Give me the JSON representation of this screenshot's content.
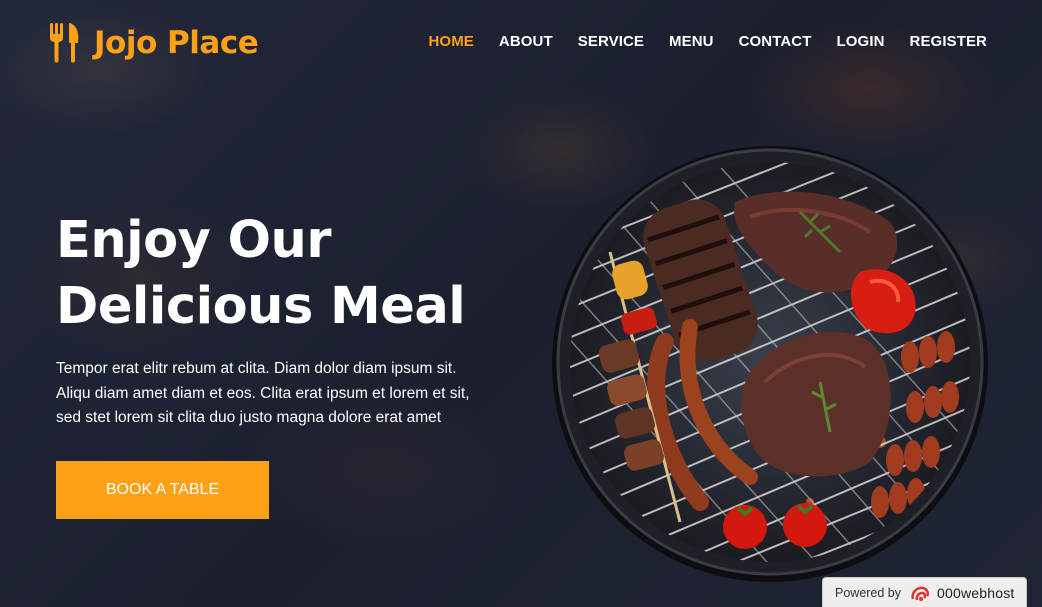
{
  "brand": {
    "name": "Jojo Place",
    "icon": "utensils-icon",
    "color": "#FEA116"
  },
  "nav": {
    "items": [
      {
        "label": "HOME",
        "active": true
      },
      {
        "label": "ABOUT",
        "active": false
      },
      {
        "label": "SERVICE",
        "active": false
      },
      {
        "label": "MENU",
        "active": false
      },
      {
        "label": "CONTACT",
        "active": false
      },
      {
        "label": "LOGIN",
        "active": false
      },
      {
        "label": "REGISTER",
        "active": false
      }
    ]
  },
  "hero": {
    "title_line1": "Enjoy Our",
    "title_line2": "Delicious Meal",
    "text_line1": "Tempor erat elitr rebum at clita. Diam dolor diam ipsum sit.",
    "text_line2": "Aliqu diam amet diam et eos. Clita erat ipsum et lorem et sit,",
    "text_line3": "sed stet lorem sit clita duo justo magna dolore erat amet",
    "cta_label": "BOOK A TABLE",
    "image": "bbq-grill-image"
  },
  "footer_badge": {
    "prefix": "Powered by",
    "host": "000webhost",
    "icon": "000webhost-logo-icon"
  },
  "colors": {
    "accent": "#FEA116",
    "background": "#1c2030",
    "text": "#ffffff"
  }
}
